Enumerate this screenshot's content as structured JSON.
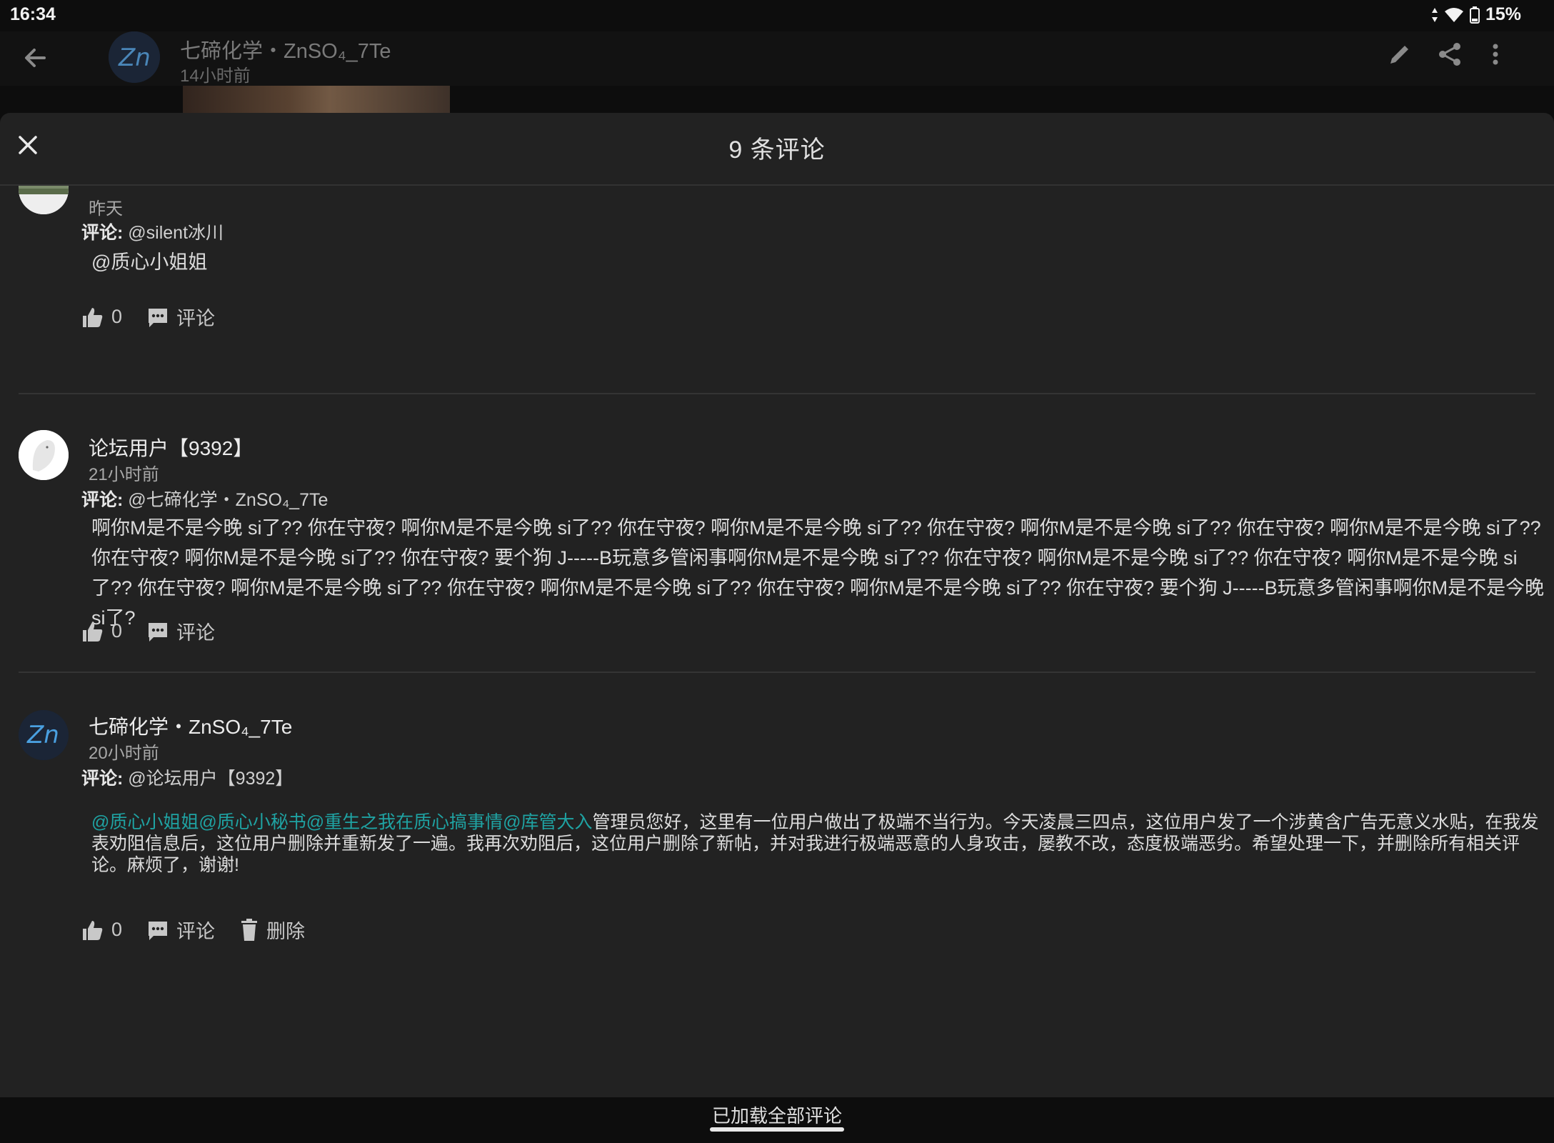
{
  "status_bar": {
    "time": "16:34",
    "battery": "15%"
  },
  "app_bar": {
    "title": "七碲化学・ZnSO₄_7Te",
    "subtitle": "14小时前",
    "avatar_text": "Zn"
  },
  "sheet": {
    "title": "9 条评论"
  },
  "comments": [
    {
      "name": "",
      "time": "昨天",
      "reply_label": "评论:",
      "reply_to": "@silent冰川",
      "body": "@质心小姐姐",
      "likes": "0",
      "comment_label": "评论"
    },
    {
      "name": "论坛用户【9392】",
      "time": "21小时前",
      "reply_label": "评论:",
      "reply_to": "@七碲化学・ZnSO₄_7Te",
      "body": "啊你M是不是今晚 si了?? 你在守夜? 啊你M是不是今晚 si了?? 你在守夜? 啊你M是不是今晚 si了?? 你在守夜? 啊你M是不是今晚 si了?? 你在守夜? 啊你M是不是今晚 si了?? 你在守夜? 啊你M是不是今晚 si了?? 你在守夜? 要个狗 J-----B玩意多管闲事啊你M是不是今晚 si了?? 你在守夜? 啊你M是不是今晚 si了?? 你在守夜? 啊你M是不是今晚 si了?? 你在守夜? 啊你M是不是今晚 si了?? 你在守夜? 啊你M是不是今晚 si了?? 你在守夜? 啊你M是不是今晚 si了?? 你在守夜? 要个狗 J-----B玩意多管闲事啊你M是不是今晚 si了?",
      "likes": "0",
      "comment_label": "评论"
    },
    {
      "name": "七碲化学・ZnSO₄_7Te",
      "time": "20小时前",
      "reply_label": "评论:",
      "reply_to": "@论坛用户【9392】",
      "mentions": "@质心小姐姐@质心小秘书@重生之我在质心搞事情@库管大入",
      "body": "管理员您好，这里有一位用户做出了极端不当行为。今天凌晨三四点，这位用户发了一个涉黄含广告无意义水贴，在我发表劝阻信息后，这位用户删除并重新发了一遍。我再次劝阻后，这位用户删除了新帖，并对我进行极端恶意的人身攻击，屡教不改，态度极端恶劣。希望处理一下，并删除所有相关评论。麻烦了，谢谢!",
      "likes": "0",
      "comment_label": "评论",
      "delete_label": "删除"
    }
  ],
  "footer": {
    "loaded_text": "已加载全部评论"
  },
  "colors": {
    "background": "#222222",
    "mention": "#1fa3a3",
    "app_bar": "#121212"
  }
}
